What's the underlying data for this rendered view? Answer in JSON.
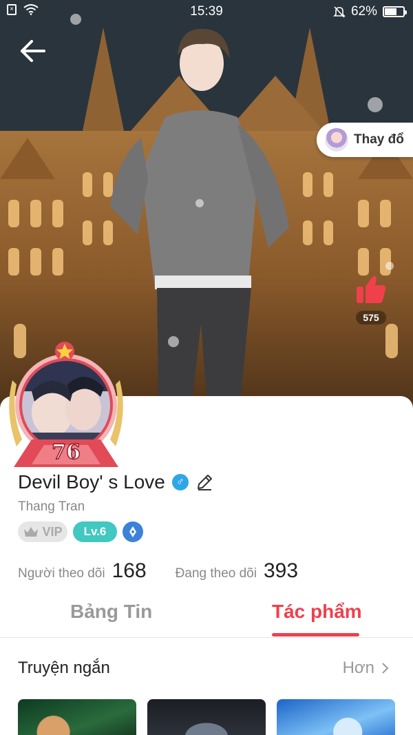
{
  "status_bar": {
    "time": "15:39",
    "battery_text": "62%",
    "icons": [
      "sim-off-icon",
      "wifi-icon",
      "bell-muted-icon",
      "battery-icon"
    ]
  },
  "hero": {
    "change_outfit_label": "Thay đổ",
    "like_count": "575"
  },
  "profile": {
    "level_number": "76",
    "name": "Devil Boy' s Love",
    "gender_symbol": "♂",
    "username": "Thang Tran",
    "vip_label": "VIP",
    "level_label": "Lv.6"
  },
  "stats": {
    "followers_label": "Người theo dõi",
    "followers_value": "168",
    "following_label": "Đang theo dõi",
    "following_value": "393"
  },
  "tabs": [
    {
      "label": "Bảng Tin",
      "active": false
    },
    {
      "label": "Tác phẩm",
      "active": true
    }
  ],
  "section": {
    "title": "Truyện ngắn",
    "more_label": "Hơn"
  },
  "colors": {
    "accent": "#f0404c",
    "level_badge": "#40c8c1",
    "gender_badge": "#2fa7e6"
  }
}
